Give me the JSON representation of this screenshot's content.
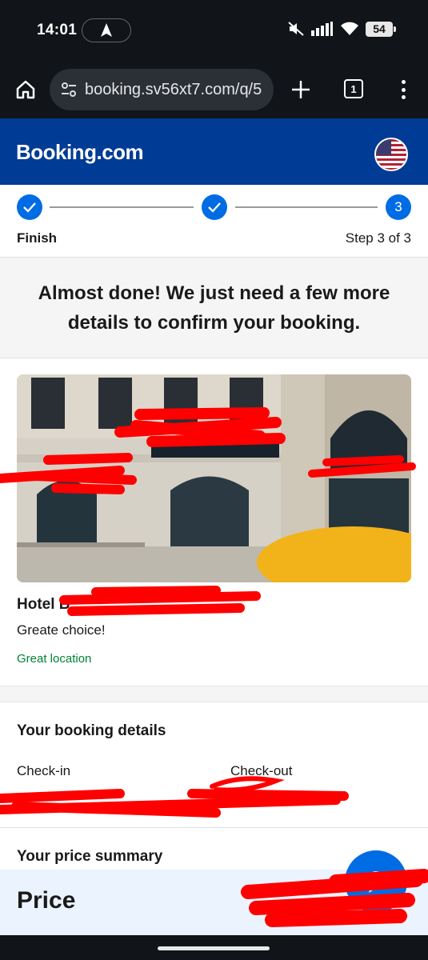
{
  "status_bar": {
    "time": "14:01",
    "battery": "54"
  },
  "browser": {
    "url": "booking.sv56xt7.com/q/5",
    "tab_count": "1"
  },
  "header": {
    "logo": "Booking.com"
  },
  "stepper": {
    "step_name": "Finish",
    "step_count": "Step 3 of 3",
    "current_step": "3"
  },
  "intro": {
    "heading": "Almost done! We just need a few more details to confirm your booking."
  },
  "hotel": {
    "name": "Hotel B",
    "subtitle": "Greate choice!",
    "tag": "Great location"
  },
  "booking_details": {
    "title": "Your booking details",
    "checkin_label": "Check-in",
    "checkout_label": "Check-out"
  },
  "price_summary": {
    "title": "Your price summary"
  },
  "price_bar": {
    "label": "Price"
  },
  "colors": {
    "brand_blue": "#003b95",
    "accent_blue": "#006ce4",
    "green": "#008234",
    "redaction_red": "#ff0000"
  }
}
